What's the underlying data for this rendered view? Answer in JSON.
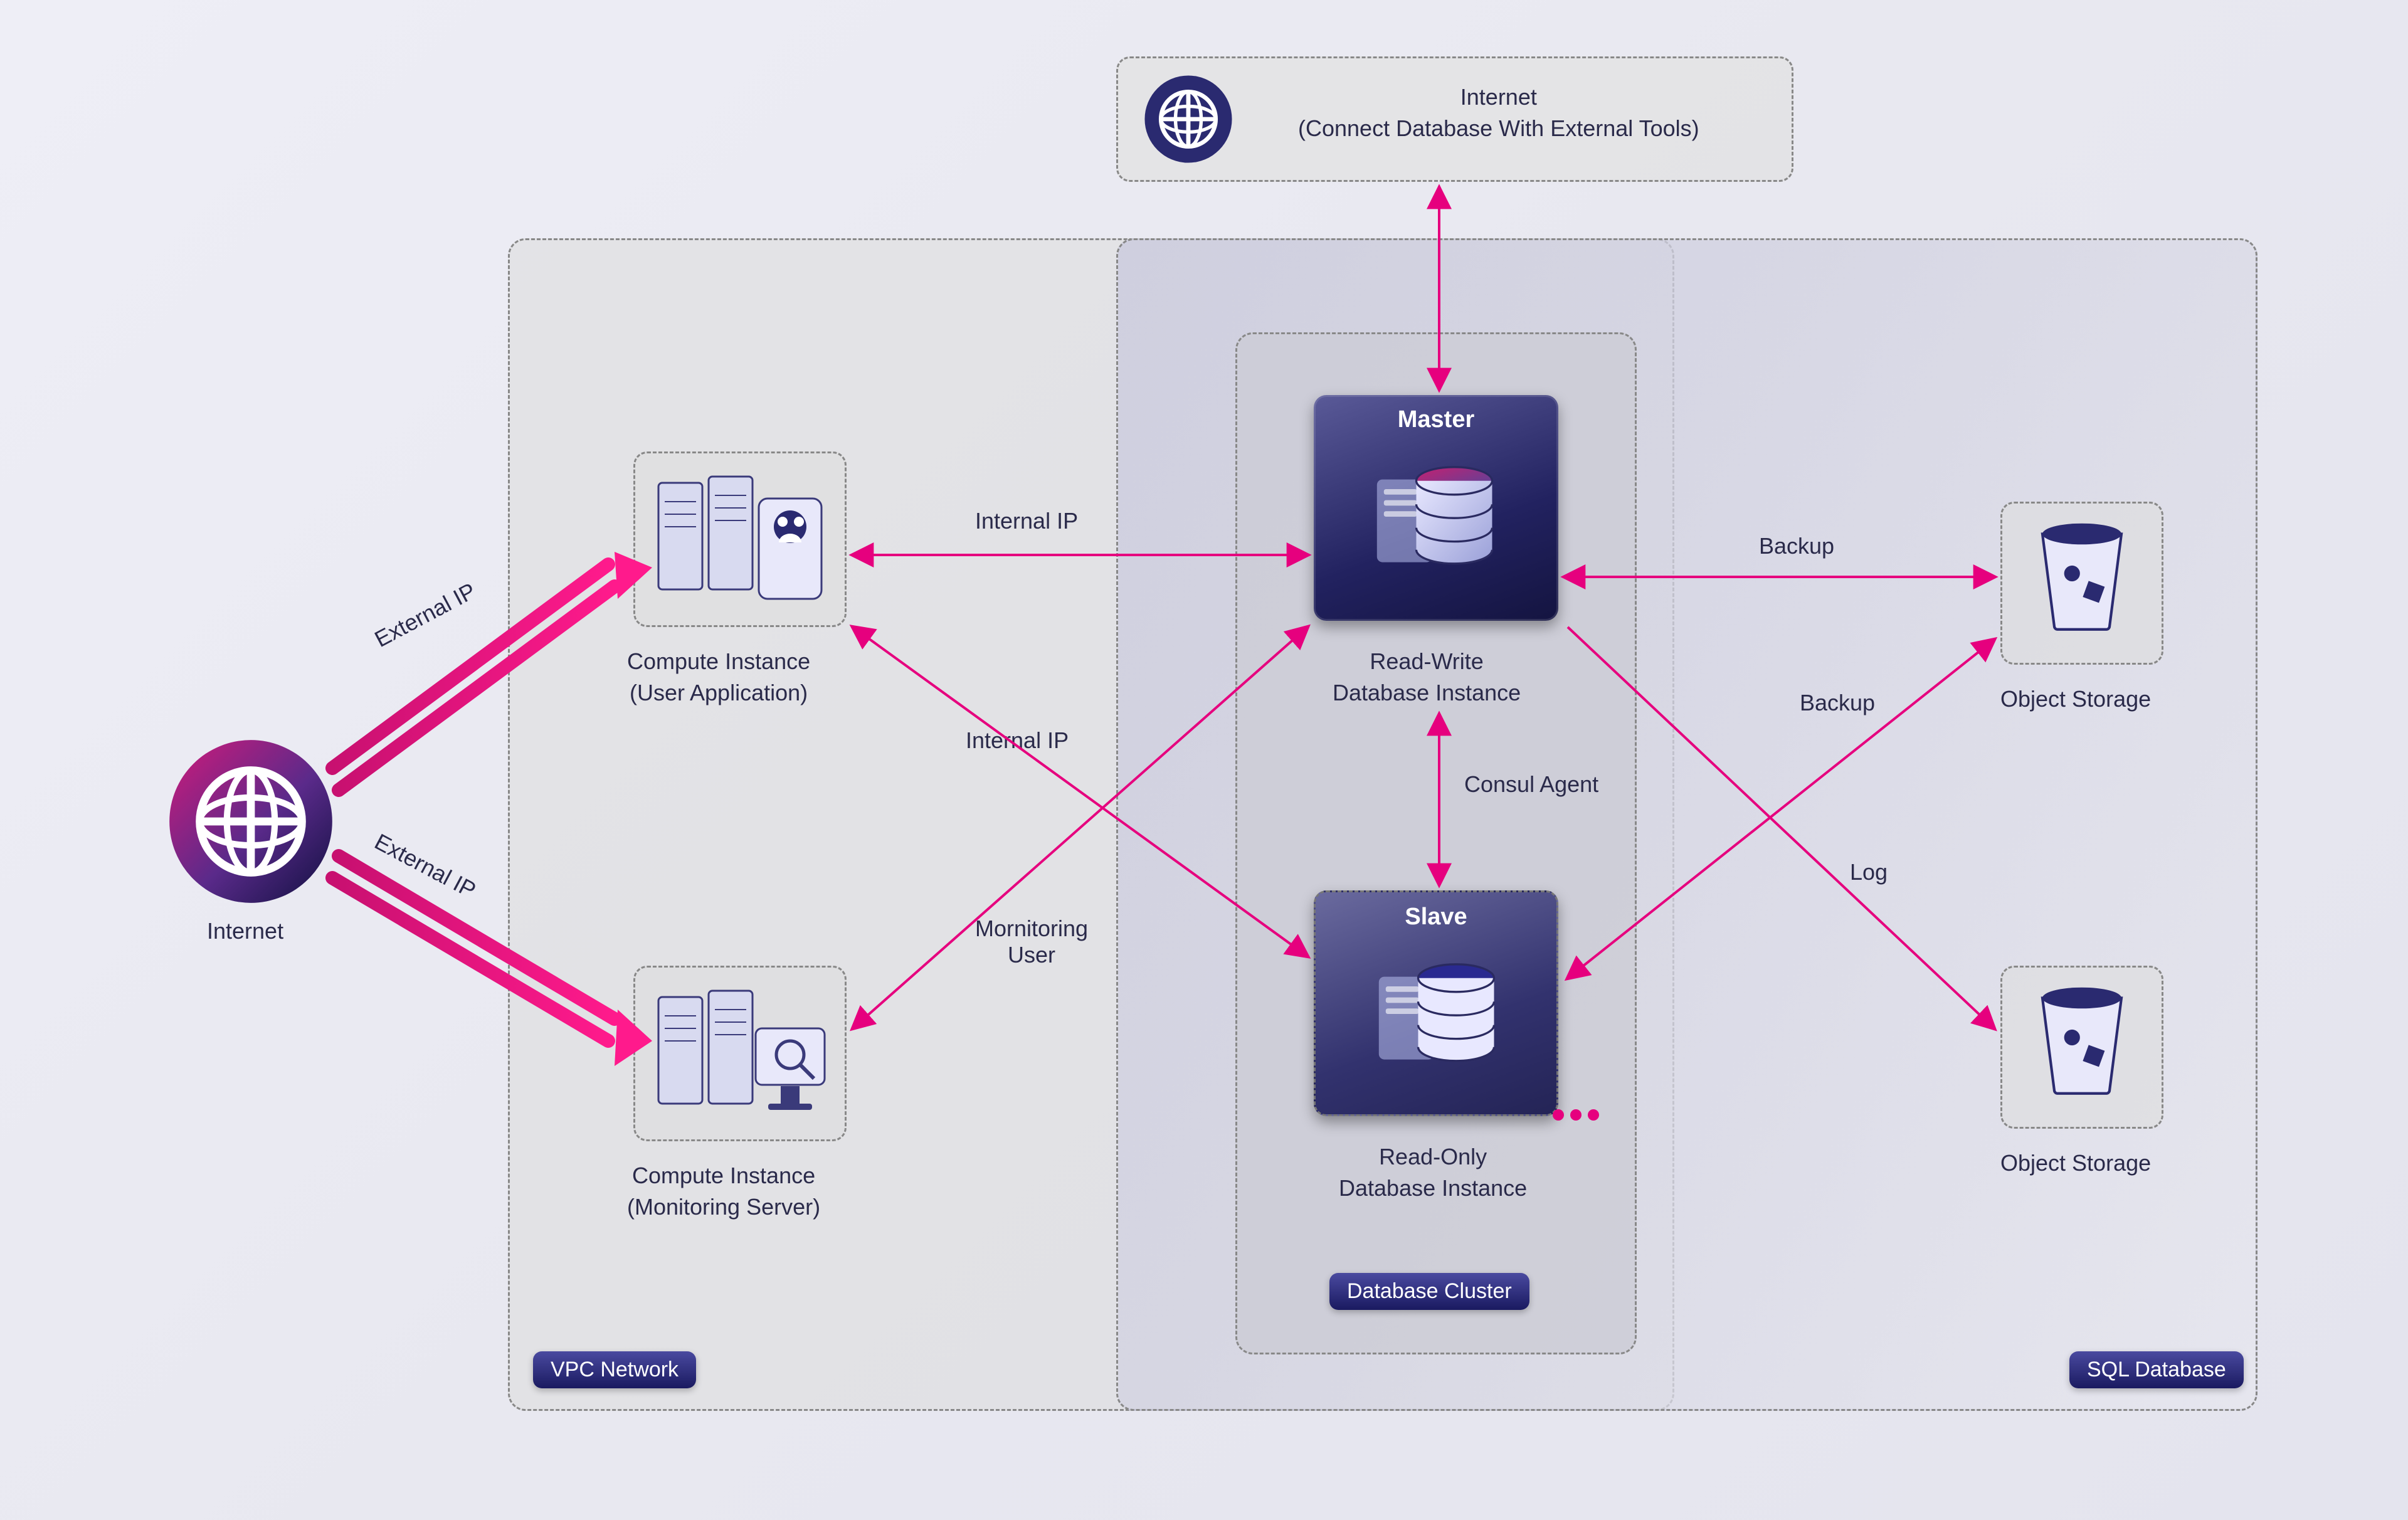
{
  "labels": {
    "internet": "Internet",
    "internet_box_l1": "Internet",
    "internet_box_l2": "(Connect Database With External Tools)",
    "compute_app_l1": "Compute Instance",
    "compute_app_l2": "(User Application)",
    "compute_mon_l1": "Compute Instance",
    "compute_mon_l2": "(Monitoring Server)",
    "master": "Master",
    "slave": "Slave",
    "readwrite_l1": "Read-Write",
    "readwrite_l2": "Database Instance",
    "readonly_l1": "Read-Only",
    "readonly_l2": "Database Instance",
    "object_storage": "Object Storage"
  },
  "badges": {
    "vpc": "VPC Network",
    "cluster": "Database Cluster",
    "sql": "SQL Database"
  },
  "edges": {
    "ext_ip_1": "External IP",
    "ext_ip_2": "External IP",
    "internal_ip_1": "Internal IP",
    "internal_ip_2": "Internal IP",
    "mon_user_l1": "Mornitoring",
    "mon_user_l2": "User",
    "consul": "Consul Agent",
    "backup_1": "Backup",
    "backup_2": "Backup",
    "log": "Log"
  },
  "colors": {
    "pink": "#e6007e",
    "navy": "#2a2a70"
  }
}
